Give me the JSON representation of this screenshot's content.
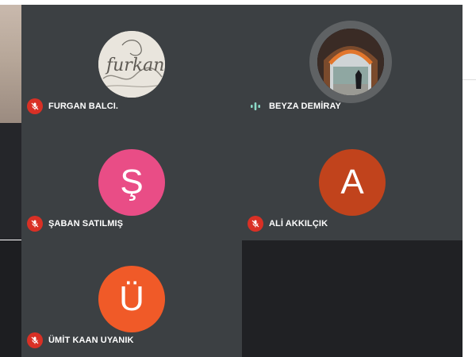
{
  "participants": [
    {
      "name": "FURGAN BALCI.",
      "mic": "muted",
      "avatar_type": "photo",
      "avatar_icon": "signature-furkan-photo",
      "avatar_photo_text": "furkan"
    },
    {
      "name": "BEYZA DEMİRAY",
      "mic": "speaking",
      "avatar_type": "photo",
      "avatar_icon": "archway-photo"
    },
    {
      "name": "ŞABAN SATILMIŞ",
      "mic": "muted",
      "avatar_type": "initial",
      "initial": "Ş",
      "color": "#e94d86"
    },
    {
      "name": "ALİ AKKILÇIK",
      "mic": "muted",
      "avatar_type": "initial",
      "initial": "A",
      "color": "#c1431c"
    },
    {
      "name": "ÜMİT KAAN UYANIK",
      "mic": "muted",
      "avatar_type": "initial",
      "initial": "Ü",
      "color": "#f05a28"
    }
  ],
  "colors": {
    "tile_bg": "#3c4043",
    "empty_tile_bg": "#202124",
    "muted_badge": "#d93025",
    "speaking_indicator": "#8bd9c7"
  }
}
